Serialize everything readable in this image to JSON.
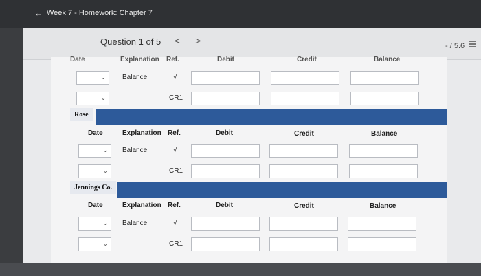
{
  "header": {
    "back_icon": "←",
    "title": "Week 7 - Homework: Chapter 7"
  },
  "question_nav": {
    "label": "Question 1 of 5",
    "prev_icon": "<",
    "next_icon": ">",
    "score": "- / 5.6"
  },
  "columns": {
    "date": "Date",
    "explanation": "Explanation",
    "ref": "Ref.",
    "debit": "Debit",
    "credit": "Credit",
    "balance": "Balance"
  },
  "top_section": {
    "partial_headers": {
      "date": "Date",
      "explanation": "Explanation",
      "ref": "Ref.",
      "debit": "Debit",
      "credit": "Credit",
      "balance": "Balance"
    },
    "row1": {
      "explanation": "Balance",
      "ref": "√"
    },
    "row2": {
      "ref": "CR1"
    }
  },
  "sections": [
    {
      "name": "Rose",
      "rows": [
        {
          "explanation": "Balance",
          "ref": "√"
        },
        {
          "ref": "CR1"
        }
      ]
    },
    {
      "name": "Jennings Co.",
      "rows": [
        {
          "explanation": "Balance",
          "ref": "√"
        },
        {
          "ref": "CR1"
        }
      ]
    }
  ],
  "icons": {
    "dropdown": "chevron-down-icon",
    "menu": "menu-icon"
  }
}
